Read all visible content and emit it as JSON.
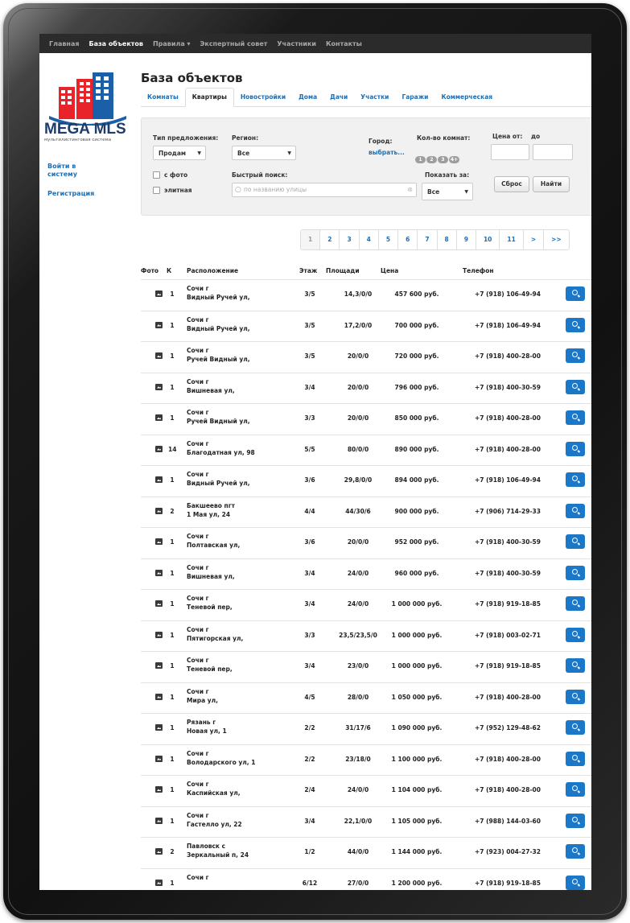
{
  "nav": {
    "items": [
      {
        "label": "Главная"
      },
      {
        "label": "База объектов"
      },
      {
        "label": "Правила ▾"
      },
      {
        "label": "Экспертный совет"
      },
      {
        "label": "Участники"
      },
      {
        "label": "Контакты"
      }
    ]
  },
  "brand": {
    "name": "MEGA MLS",
    "subtitle": "мультилистинговая система",
    "colors": {
      "red": "#e8232a",
      "blue": "#1a5fa8",
      "dark": "#1e3c6e"
    }
  },
  "sidebar": {
    "login": "Войти в систему",
    "register": "Регистрация"
  },
  "page": {
    "title": "База объектов",
    "tabs": [
      "Комнаты",
      "Квартиры",
      "Новостройки",
      "Дома",
      "Дачи",
      "Участки",
      "Гаражи",
      "Коммерческая"
    ],
    "active_tab": "Квартиры"
  },
  "filter": {
    "offer_type_label": "Тип предложения:",
    "offer_type_value": "Продам",
    "region_label": "Регион:",
    "region_value": "Все",
    "city_label": "Город:",
    "city_link": "выбрать...",
    "rooms_label": "Кол-во комнат:",
    "rooms_options": [
      "1",
      "2",
      "3",
      "4+"
    ],
    "price_label": "Цена от:",
    "price_to_label": "до",
    "with_photo": "с фото",
    "elite": "элитная",
    "quick_search_label": "Быстрый поиск:",
    "quick_search_placeholder": "по названию улицы",
    "show_label": "Показать за:",
    "show_value": "Все",
    "reset_label": "Сброс",
    "find_label": "Найти"
  },
  "pagination": [
    "1",
    "2",
    "3",
    "4",
    "5",
    "6",
    "7",
    "8",
    "9",
    "10",
    "11",
    ">",
    ">>"
  ],
  "table": {
    "headers": {
      "photo": "Фото",
      "rooms": "К",
      "location": "Расположение",
      "floor": "Этаж",
      "area": "Площади",
      "price": "Цена",
      "phone": "Телефон"
    },
    "rows": [
      {
        "rooms": "1",
        "city": "Сочи г",
        "street": "Видный Ручей ул,",
        "floor": "3/5",
        "area": "14,3/0/0",
        "price": "457 600 руб.",
        "phone": "+7 (918) 106-49-94"
      },
      {
        "rooms": "1",
        "city": "Сочи г",
        "street": "Видный Ручей ул,",
        "floor": "3/5",
        "area": "17,2/0/0",
        "price": "700 000 руб.",
        "phone": "+7 (918) 106-49-94"
      },
      {
        "rooms": "1",
        "city": "Сочи г",
        "street": "Ручей Видный ул,",
        "floor": "3/5",
        "area": "20/0/0",
        "price": "720 000 руб.",
        "phone": "+7 (918) 400-28-00"
      },
      {
        "rooms": "1",
        "city": "Сочи г",
        "street": "Вишневая ул,",
        "floor": "3/4",
        "area": "20/0/0",
        "price": "796 000 руб.",
        "phone": "+7 (918) 400-30-59"
      },
      {
        "rooms": "1",
        "city": "Сочи г",
        "street": "Ручей Видный ул,",
        "floor": "3/3",
        "area": "20/0/0",
        "price": "850 000 руб.",
        "phone": "+7 (918) 400-28-00"
      },
      {
        "rooms": "14",
        "city": "Сочи г",
        "street": "Благодатная ул, 98",
        "floor": "5/5",
        "area": "80/0/0",
        "price": "890 000 руб.",
        "phone": "+7 (918) 400-28-00"
      },
      {
        "rooms": "1",
        "city": "Сочи г",
        "street": "Видный Ручей ул,",
        "floor": "3/6",
        "area": "29,8/0/0",
        "price": "894 000 руб.",
        "phone": "+7 (918) 106-49-94"
      },
      {
        "rooms": "2",
        "city": "Бакшеево пгт",
        "street": "1 Мая ул, 24",
        "floor": "4/4",
        "area": "44/30/6",
        "price": "900 000 руб.",
        "phone": "+7 (906) 714-29-33"
      },
      {
        "rooms": "1",
        "city": "Сочи г",
        "street": "Полтавская ул,",
        "floor": "3/6",
        "area": "20/0/0",
        "price": "952 000 руб.",
        "phone": "+7 (918) 400-30-59"
      },
      {
        "rooms": "1",
        "city": "Сочи г",
        "street": "Вишневая ул,",
        "floor": "3/4",
        "area": "24/0/0",
        "price": "960 000 руб.",
        "phone": "+7 (918) 400-30-59"
      },
      {
        "rooms": "1",
        "city": "Сочи г",
        "street": "Теневой пер,",
        "floor": "3/4",
        "area": "24/0/0",
        "price": "1 000 000 руб.",
        "phone": "+7 (918) 919-18-85"
      },
      {
        "rooms": "1",
        "city": "Сочи г",
        "street": "Пятигорская ул,",
        "floor": "3/3",
        "area": "23,5/23,5/0",
        "price": "1 000 000 руб.",
        "phone": "+7 (918) 003-02-71"
      },
      {
        "rooms": "1",
        "city": "Сочи г",
        "street": "Теневой пер,",
        "floor": "3/4",
        "area": "23/0/0",
        "price": "1 000 000 руб.",
        "phone": "+7 (918) 919-18-85"
      },
      {
        "rooms": "1",
        "city": "Сочи г",
        "street": "Мира ул,",
        "floor": "4/5",
        "area": "28/0/0",
        "price": "1 050 000 руб.",
        "phone": "+7 (918) 400-28-00"
      },
      {
        "rooms": "1",
        "city": "Рязань г",
        "street": "Новая ул, 1",
        "floor": "2/2",
        "area": "31/17/6",
        "price": "1 090 000 руб.",
        "phone": "+7 (952) 129-48-62"
      },
      {
        "rooms": "1",
        "city": "Сочи г",
        "street": "Володарского ул, 1",
        "floor": "2/2",
        "area": "23/18/0",
        "price": "1 100 000 руб.",
        "phone": "+7 (918) 400-28-00"
      },
      {
        "rooms": "1",
        "city": "Сочи г",
        "street": "Каспийская ул,",
        "floor": "2/4",
        "area": "24/0/0",
        "price": "1 104 000 руб.",
        "phone": "+7 (918) 400-28-00"
      },
      {
        "rooms": "1",
        "city": "Сочи г",
        "street": "Гастелло ул, 22",
        "floor": "3/4",
        "area": "22,1/0/0",
        "price": "1 105 000 руб.",
        "phone": "+7 (988) 144-03-60"
      },
      {
        "rooms": "2",
        "city": "Павловск с",
        "street": "Зеркальный п, 24",
        "floor": "1/2",
        "area": "44/0/0",
        "price": "1 144 000 руб.",
        "phone": "+7 (923) 004-27-32"
      },
      {
        "rooms": "1",
        "city": "Сочи г",
        "street": "",
        "floor": "6/12",
        "area": "27/0/0",
        "price": "1 200 000 руб.",
        "phone": "+7 (918) 919-18-85"
      }
    ]
  }
}
